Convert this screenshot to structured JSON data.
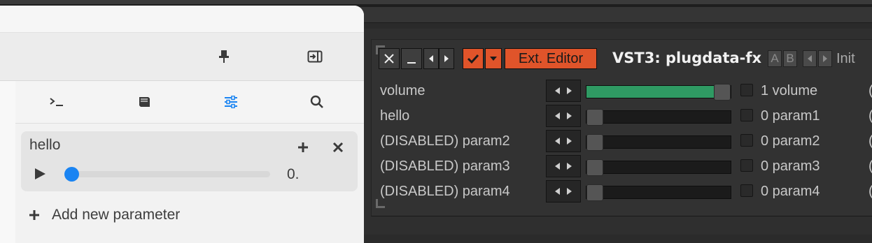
{
  "plugdata": {
    "toolbar": {
      "pin_icon": "pin-icon",
      "exit_panel_icon": "exit-panel-icon"
    },
    "sidebar_tabs": [
      {
        "name": "console",
        "icon": "terminal-icon"
      },
      {
        "name": "documentation",
        "icon": "book-icon"
      },
      {
        "name": "parameters",
        "icon": "sliders-icon",
        "active": true
      },
      {
        "name": "search",
        "icon": "search-icon"
      }
    ],
    "parameter": {
      "name": "hello",
      "value_text": "0.",
      "slider_fraction": 0
    },
    "add_parameter_label": "Add new parameter",
    "colors": {
      "accent": "#1a84f2"
    }
  },
  "vst": {
    "ext_editor_label": "Ext. Editor",
    "title": "VST3: plugdata-fx",
    "ab": {
      "a": "A",
      "b": "B"
    },
    "preset_name": "Init",
    "accent_color": "#e0542a",
    "params": [
      {
        "label": "volume",
        "value": "1 volume",
        "fraction": 1.0
      },
      {
        "label": "hello",
        "value": "0 param1",
        "fraction": 0.0
      },
      {
        "label": "(DISABLED) param2",
        "value": "0 param2",
        "fraction": 0.0
      },
      {
        "label": "(DISABLED) param3",
        "value": "0 param3",
        "fraction": 0.0
      },
      {
        "label": "(DISABLED) param4",
        "value": "0 param4",
        "fraction": 0.0
      }
    ]
  }
}
